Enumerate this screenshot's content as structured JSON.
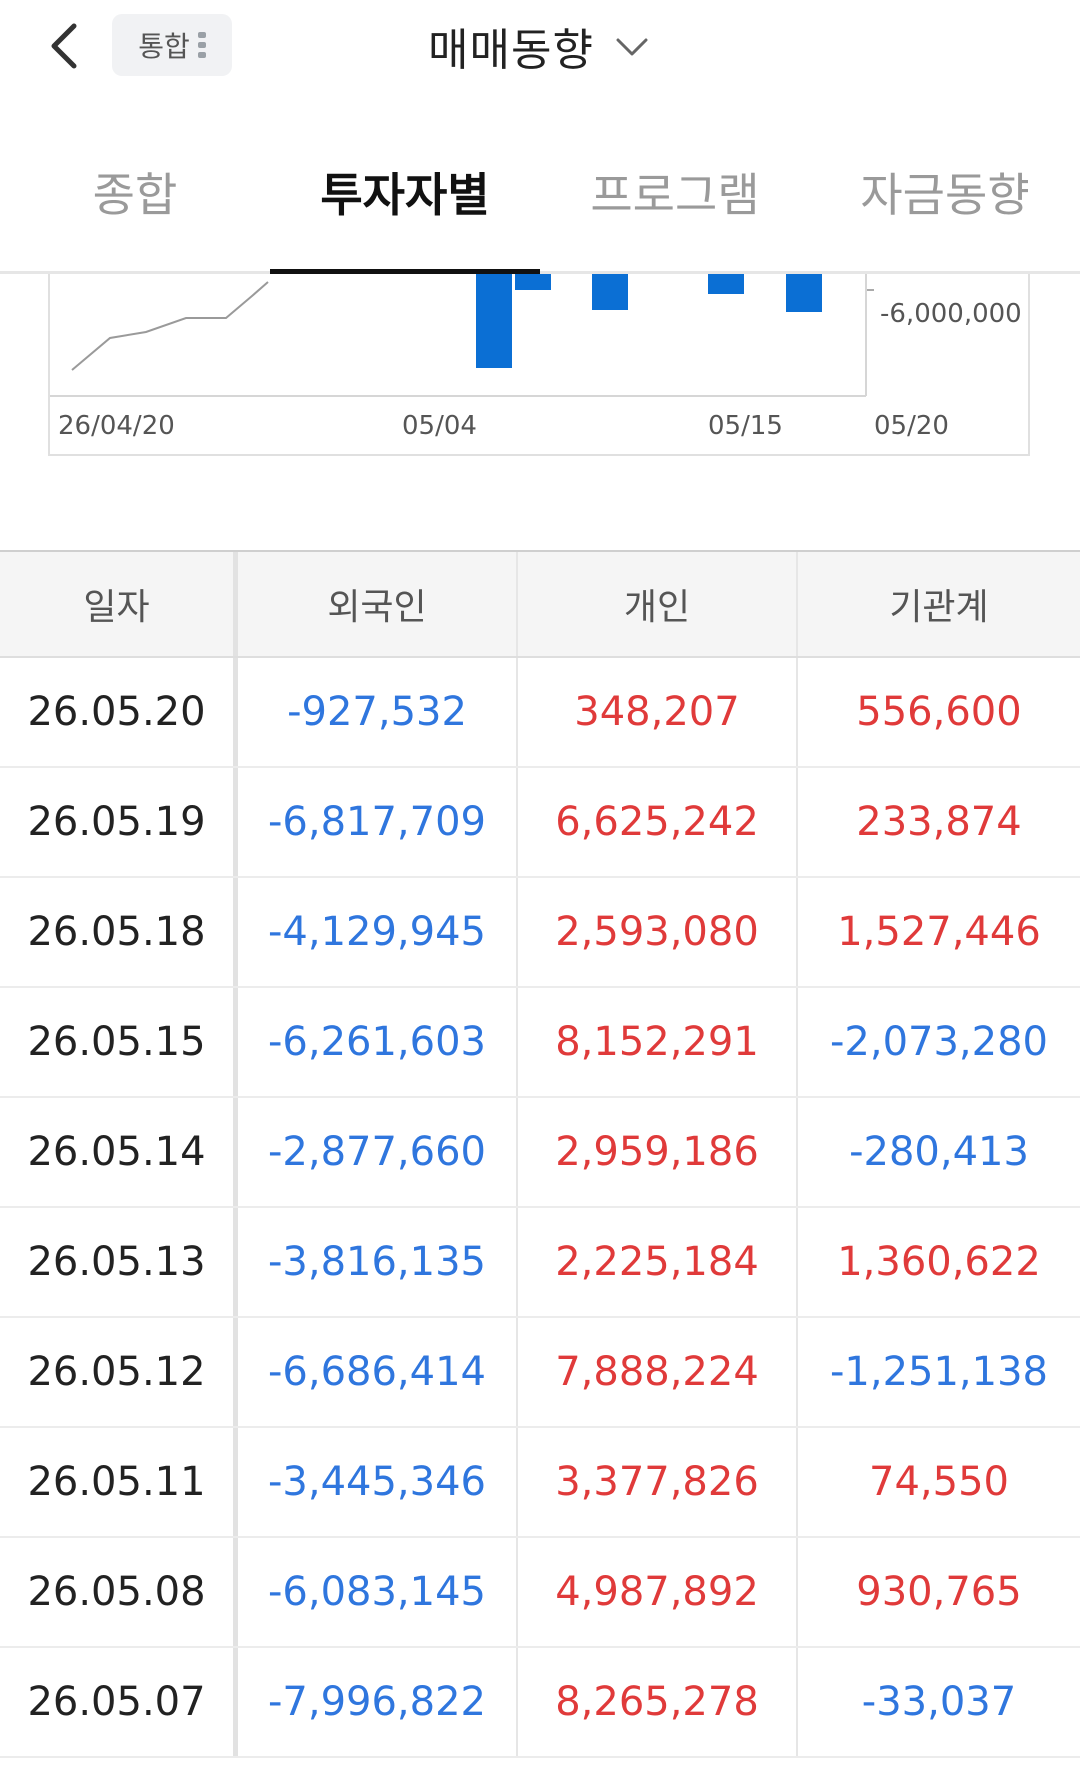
{
  "header": {
    "market_chip_label": "통합",
    "title": "매매동향"
  },
  "tabs": [
    {
      "label": "종합",
      "active": false
    },
    {
      "label": "투자자별",
      "active": true
    },
    {
      "label": "프로그램",
      "active": false
    },
    {
      "label": "자금동향",
      "active": false
    }
  ],
  "chart": {
    "y_tick_label": "-6,000,000",
    "x_tick_labels": [
      "26/04/20",
      "05/04",
      "05/15",
      "05/20"
    ],
    "colors": {
      "bar": "#0b6fd4",
      "line": "#9a9a9a"
    }
  },
  "table": {
    "headers": [
      "일자",
      "외국인",
      "개인",
      "기관계"
    ],
    "rows": [
      {
        "date": "26.05.20",
        "foreign": "-927,532",
        "individual": "348,207",
        "institution": "556,600"
      },
      {
        "date": "26.05.19",
        "foreign": "-6,817,709",
        "individual": "6,625,242",
        "institution": "233,874"
      },
      {
        "date": "26.05.18",
        "foreign": "-4,129,945",
        "individual": "2,593,080",
        "institution": "1,527,446"
      },
      {
        "date": "26.05.15",
        "foreign": "-6,261,603",
        "individual": "8,152,291",
        "institution": "-2,073,280"
      },
      {
        "date": "26.05.14",
        "foreign": "-2,877,660",
        "individual": "2,959,186",
        "institution": "-280,413"
      },
      {
        "date": "26.05.13",
        "foreign": "-3,816,135",
        "individual": "2,225,184",
        "institution": "1,360,622"
      },
      {
        "date": "26.05.12",
        "foreign": "-6,686,414",
        "individual": "7,888,224",
        "institution": "-1,251,138"
      },
      {
        "date": "26.05.11",
        "foreign": "-3,445,346",
        "individual": "3,377,826",
        "institution": "74,550"
      },
      {
        "date": "26.05.08",
        "foreign": "-6,083,145",
        "individual": "4,987,892",
        "institution": "930,765"
      },
      {
        "date": "26.05.07",
        "foreign": "-7,996,822",
        "individual": "8,265,278",
        "institution": "-33,037"
      }
    ]
  },
  "colors": {
    "negative": "#2f76de",
    "positive": "#e03a3a"
  }
}
